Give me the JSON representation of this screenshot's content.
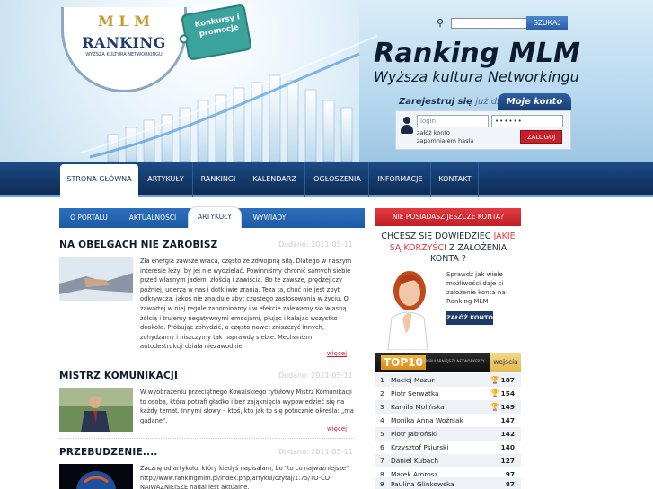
{
  "header": {
    "logo_mlm": "M L M",
    "logo_text": "RANKING",
    "logo_sub": "WYŻSZA KULTURA NETWORKINGU",
    "promo_tag": "Konkursy i promocje",
    "brand_title": "Ranking MLM",
    "brand_subtitle": "Wyższa kultura Networkingu",
    "search_button": "SZUKAJ",
    "register_prefix": "Zarejestruj się",
    "register_suffix": "już dziś",
    "account_label": "Moje konto",
    "login_placeholder": "login",
    "password_mask": "••••••",
    "link_create": "załóż konto",
    "link_forgot": "zapomniałem hasła",
    "login_button": "ZALOGUJ"
  },
  "nav": {
    "items": [
      "STRONA GŁÓWNA",
      "ARTYKUŁY",
      "RANKINGI",
      "KALENDARZ",
      "OGŁOSZENIA",
      "INFORMACJE",
      "KONTAKT"
    ]
  },
  "subtabs": {
    "items": [
      "O PORTALU",
      "AKTUALNOŚCI",
      "ARTYKUŁY",
      "WYWIADY"
    ]
  },
  "articles": [
    {
      "title": "NA OBELGACH NIE ZAROBISZ",
      "date": "Dodano: 2011-05-11",
      "text": "Zła energia zawsze wraca, często ze zdwojoną siłą. Dlatego w naszym interesie leży, by jej nie wydzielać. Powinniśmy chronić samych siebie przed własnym jadem, złością i zawiścią. Bo te zawsze, prędzej czy później, uderzą w nas i dotkliwie zranią. Teza ta, choć nie jest zbyt odkrywcza, jakoś nie znajduje zbyt częstego zastosowania w życiu. O zawartej w niej regule zapominamy i w efekcie zalewamy się własną żółcią i trujemy negatywnymi emocjami, plując i kalając wszystko dookoła. Próbując zohydzić, a często nawet zniszczyć innych, zohydzamy i niszczymy tak naprawdę siebie. Mechanizm autodestrukcji działa niezawodnie.",
      "more": "więcej"
    },
    {
      "title": "MISTRZ KOMUNIKACJI",
      "date": "Dodano: 2011-05-11",
      "text": "W wyobrażeniu przeciętnego Kowalskiego tytułowy Mistrz Komunikacji to osoba, która potrafi gładko i bez zająknięcia wypowiedzieć się na każdy temat. Innymi słowy – ktoś, kto jak to się potocznie określa: „ma gadane\".",
      "more": "więcej"
    },
    {
      "title": "PRZEBUDZENIE....",
      "date": "Dodano: 2011-05-11",
      "text": "Zacznę od artykułu, który kiedyś napisałam, bo \"to co najważniejsze\" http://www.rankingmlm.pl/index.php/artykul/czytaj/1:75/TO-CO-NAJWAZNIEJSZE nadal jest aktualne.",
      "more": ""
    }
  ],
  "sidebar": {
    "no_account": "NIE POSIADASZ JESZCZE KONTA?",
    "question_1": "CHCESZ SIĘ DOWIEDZIEĆ",
    "question_red": "JAKIE SĄ KORZYŚCI",
    "question_2": "Z ZAŁOŻENIA KONTA ?",
    "check_text": "Sprawdź jak wiele możliwości daje ci założenie konta na Ranking MLM",
    "create_button": "ZAŁÓŻ KONTO",
    "top10_label": "TOP10",
    "top10_sub": "NAJPOPULARNIEJSZY NETWORKERZY",
    "visits_label": "wejścia",
    "ranking": [
      {
        "n": "1",
        "name": "Maciej Mazur",
        "icon": "trophy-gold",
        "value": "187"
      },
      {
        "n": "2",
        "name": "Piotr Serwatka",
        "icon": "trophy-dark",
        "value": "154"
      },
      {
        "n": "3",
        "name": "Kamila Molińska",
        "icon": "trophy-bronze",
        "value": "149"
      },
      {
        "n": "4",
        "name": "Monika Anna Woźniak",
        "icon": "",
        "value": "147"
      },
      {
        "n": "5",
        "name": "Piotr Jabłoński",
        "icon": "",
        "value": "142"
      },
      {
        "n": "6",
        "name": "Krzysztof Psiurski",
        "icon": "",
        "value": "140"
      },
      {
        "n": "7",
        "name": "Daniel Kubach",
        "icon": "",
        "value": "127"
      },
      {
        "n": "8",
        "name": "Marek Amrosz",
        "icon": "",
        "value": "97"
      },
      {
        "n": "9",
        "name": "Paulina Glinkowska",
        "icon": "",
        "value": "87"
      }
    ]
  }
}
